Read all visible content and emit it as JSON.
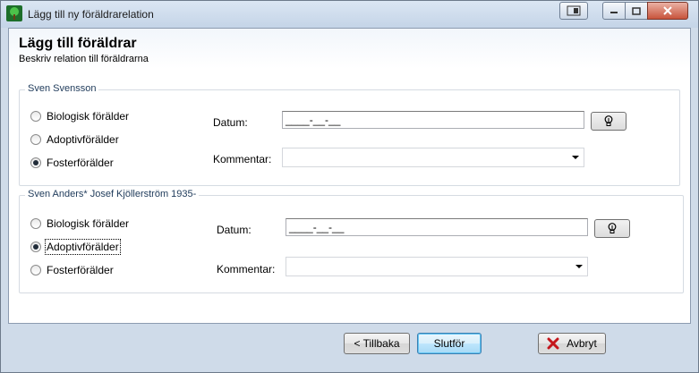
{
  "window": {
    "title": "Lägg till ny föräldrarelation"
  },
  "header": {
    "title": "Lägg till föräldrar",
    "subtitle": "Beskriv relation till föräldrarna"
  },
  "parents": [
    {
      "name": "Sven Svensson",
      "options": [
        "Biologisk förälder",
        "Adoptivförälder",
        "Fosterförälder"
      ],
      "selected": "Fosterförälder",
      "date_label": "Datum:",
      "date_value": "____-__-__",
      "comment_label": "Kommentar:",
      "comment_value": ""
    },
    {
      "name": "Sven Anders* Josef Kjöllerström 1935-",
      "options": [
        "Biologisk förälder",
        "Adoptivförälder",
        "Fosterförälder"
      ],
      "selected": "Adoptivförälder",
      "date_label": "Datum:",
      "date_value": "____-__-__",
      "comment_label": "Kommentar:",
      "comment_value": ""
    }
  ],
  "footer": {
    "back_label": "< Tillbaka",
    "finish_label": "Slutför",
    "cancel_label": "Avbryt"
  },
  "icons": {
    "app": "tree-icon",
    "date_picker": "lightbulb-icon",
    "cancel": "red-x-icon"
  },
  "colors": {
    "title_bar": "#c4d4e7",
    "close_button": "#c8543c",
    "default_button": "#a7d9f5",
    "group_title": "#1e3a5a"
  }
}
